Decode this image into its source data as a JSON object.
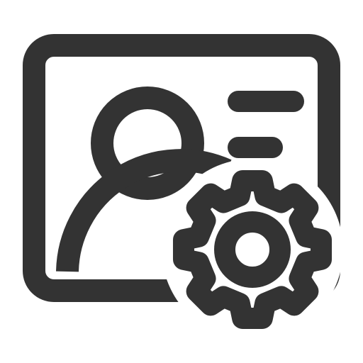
{
  "icon": {
    "name": "user-profile-settings-icon",
    "parts": [
      "id-card-icon",
      "user-avatar-icon",
      "gear-icon"
    ],
    "color": "#333333",
    "background": "#ffffff"
  }
}
